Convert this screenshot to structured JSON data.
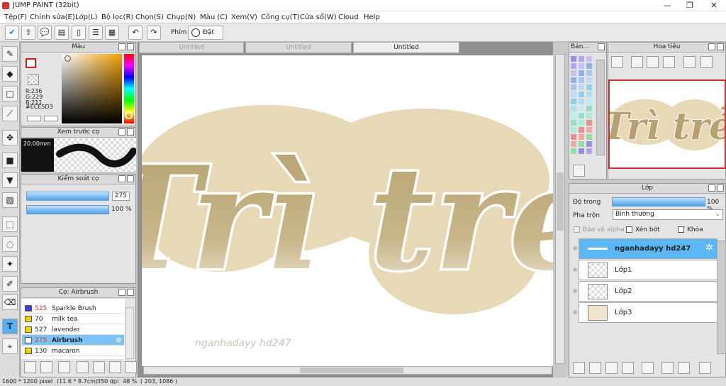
{
  "window": {
    "title": "JUMP PAINT (32bit)",
    "min": "—",
    "max": "❐",
    "close": "✕"
  },
  "menu": [
    "Tệp(F)",
    "Chỉnh sửa(E)",
    "Lớp(L)",
    "Bộ lọc(R)",
    "Chọn(S)",
    "Chụp(N)",
    "Màu (C)",
    "Xem(V)",
    "Công cụ(T)",
    "Cửa sổ(W)",
    "Cloud",
    "Help"
  ],
  "toolbar": {
    "phim_label": "Phím",
    "reset_label": "Đặt lại"
  },
  "color_panel": {
    "title": "Màu",
    "r": "R:236",
    "g": "G:229",
    "b": "B:211",
    "hex": "#ECE5D3",
    "fg": "#ECE5D3"
  },
  "brush_preview": {
    "title": "Xem trước cọ",
    "size": "20.00mm"
  },
  "brush_control": {
    "title": "Kiểm soát cọ",
    "size_value": "275",
    "opacity_value": "100 %"
  },
  "brush_list": {
    "title": "Cọ: Airbrush",
    "items": [
      {
        "num": "525",
        "name": "Sparkle Brush",
        "color": "#3a3adf"
      },
      {
        "num": "70",
        "name": "milk tea",
        "color": "#e8d800"
      },
      {
        "num": "527",
        "name": "lavender",
        "color": "#e8d800"
      },
      {
        "num": "275",
        "name": "Airbrush",
        "color": "#ffffff"
      },
      {
        "num": "130",
        "name": "macaron",
        "color": "#e8d800"
      }
    ]
  },
  "tabs": [
    "Untitled",
    "Untitled",
    "Untitled"
  ],
  "canvas": {
    "text_main": "Trì trẻ",
    "watermark": "nganhadayy hd247"
  },
  "palette_panel": {
    "title": "Bản..."
  },
  "navigator": {
    "title": "Hoa tiêu"
  },
  "layers": {
    "title": "Lớp",
    "opacity_label": "Độ trong",
    "opacity_value": "100 %",
    "blend_label": "Pha trộn",
    "blend_value": "Bình thường",
    "protect_alpha": "Bảo vệ alpha",
    "clip": "Xén bớt",
    "lock": "Khóa",
    "items": [
      {
        "name": "nganhadayy hd247"
      },
      {
        "name": "Lớp1"
      },
      {
        "name": "Lớp2"
      },
      {
        "name": "Lớp3"
      }
    ]
  },
  "status": {
    "size": "1600 * 1200 pixel",
    "cm": "(11.6 * 8.7cm)",
    "dpi": "350 dpi",
    "zoom": "48 %",
    "coords": "( 203, 1086 )"
  }
}
